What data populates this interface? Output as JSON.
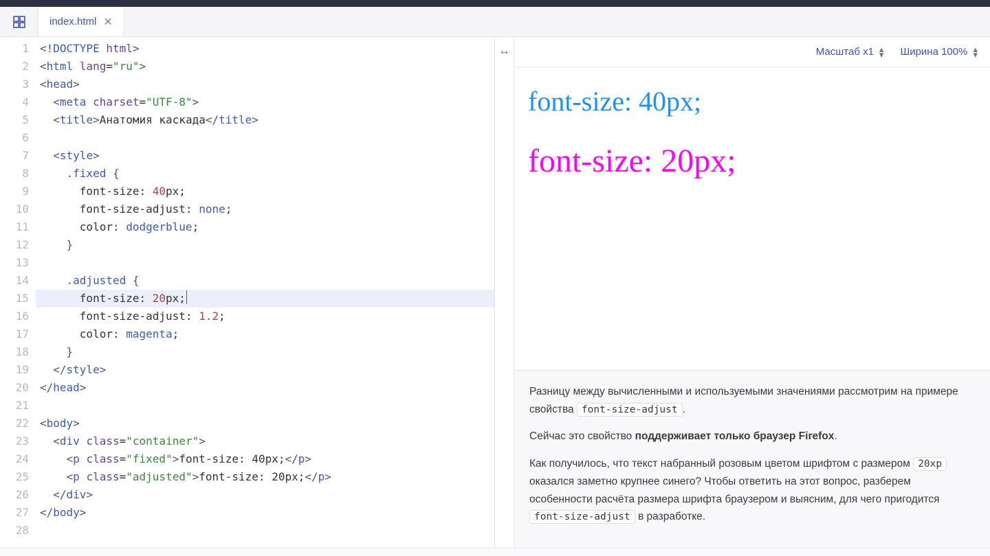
{
  "tab": {
    "filename": "index.html"
  },
  "toolbar": {
    "zoom_label": "Масштаб x1",
    "width_label": "Ширина 100%"
  },
  "editor": {
    "active_line": 15,
    "lines": [
      {
        "n": "1",
        "html": "<span class='cl-punct'>&lt;!</span><span class='cl-tag'>DOCTYPE</span> <span class='cl-attr'>html</span><span class='cl-punct'>&gt;</span>"
      },
      {
        "n": "2",
        "html": "<span class='cl-punct'>&lt;</span><span class='cl-tag'>html</span> <span class='cl-attr'>lang</span>=<span class='cl-str'>\"ru\"</span><span class='cl-punct'>&gt;</span>"
      },
      {
        "n": "3",
        "html": "<span class='cl-punct'>&lt;</span><span class='cl-tag'>head</span><span class='cl-punct'>&gt;</span>"
      },
      {
        "n": "4",
        "html": "  <span class='cl-punct'>&lt;</span><span class='cl-tag'>meta</span> <span class='cl-attr'>charset</span>=<span class='cl-str'>\"UTF-8\"</span><span class='cl-punct'>&gt;</span>"
      },
      {
        "n": "5",
        "html": "  <span class='cl-punct'>&lt;</span><span class='cl-tag'>title</span><span class='cl-punct'>&gt;</span><span class='cl-text'>Анатомия каскада</span><span class='cl-punct'>&lt;/</span><span class='cl-tag'>title</span><span class='cl-punct'>&gt;</span>"
      },
      {
        "n": "6",
        "html": ""
      },
      {
        "n": "7",
        "html": "  <span class='cl-punct'>&lt;</span><span class='cl-tag'>style</span><span class='cl-punct'>&gt;</span>"
      },
      {
        "n": "8",
        "html": "    <span class='cl-css'>.fixed</span> <span class='cl-punct'>{</span>"
      },
      {
        "n": "9",
        "html": "      <span class='cl-text'>font-size:</span> <span class='cl-num'>40</span><span class='cl-text'>px;</span>"
      },
      {
        "n": "10",
        "html": "      <span class='cl-text'>font-size-adjust:</span> <span class='cl-val'>none</span><span class='cl-text'>;</span>"
      },
      {
        "n": "11",
        "html": "      <span class='cl-text'>color:</span> <span class='cl-val'>dodgerblue</span><span class='cl-text'>;</span>"
      },
      {
        "n": "12",
        "html": "    <span class='cl-punct'>}</span>"
      },
      {
        "n": "13",
        "html": ""
      },
      {
        "n": "14",
        "html": "    <span class='cl-css'>.adjusted</span> <span class='cl-punct'>{</span>"
      },
      {
        "n": "15",
        "html": "      <span class='cl-text'>font-size:</span> <span class='cl-num'>20</span><span class='cl-text'>px;</span>",
        "hl": true,
        "caret": true
      },
      {
        "n": "16",
        "html": "      <span class='cl-text'>font-size-adjust:</span> <span class='cl-num'>1.2</span><span class='cl-text'>;</span>"
      },
      {
        "n": "17",
        "html": "      <span class='cl-text'>color:</span> <span class='cl-val'>magenta</span><span class='cl-text'>;</span>"
      },
      {
        "n": "18",
        "html": "    <span class='cl-punct'>}</span>"
      },
      {
        "n": "19",
        "html": "  <span class='cl-punct'>&lt;/</span><span class='cl-tag'>style</span><span class='cl-punct'>&gt;</span>"
      },
      {
        "n": "20",
        "html": "<span class='cl-punct'>&lt;/</span><span class='cl-tag'>head</span><span class='cl-punct'>&gt;</span>"
      },
      {
        "n": "21",
        "html": ""
      },
      {
        "n": "22",
        "html": "<span class='cl-punct'>&lt;</span><span class='cl-tag'>body</span><span class='cl-punct'>&gt;</span>"
      },
      {
        "n": "23",
        "html": "  <span class='cl-punct'>&lt;</span><span class='cl-tag'>div</span> <span class='cl-attr'>class</span>=<span class='cl-str'>\"container\"</span><span class='cl-punct'>&gt;</span>"
      },
      {
        "n": "24",
        "html": "    <span class='cl-punct'>&lt;</span><span class='cl-tag'>p</span> <span class='cl-attr'>class</span>=<span class='cl-str'>\"fixed\"</span><span class='cl-punct'>&gt;</span><span class='cl-text'>font-size: 40px;</span><span class='cl-punct'>&lt;/</span><span class='cl-tag'>p</span><span class='cl-punct'>&gt;</span>"
      },
      {
        "n": "25",
        "html": "    <span class='cl-punct'>&lt;</span><span class='cl-tag'>p</span> <span class='cl-attr'>class</span>=<span class='cl-str'>\"adjusted\"</span><span class='cl-punct'>&gt;</span><span class='cl-text'>font-size: 20px;</span><span class='cl-punct'>&lt;/</span><span class='cl-tag'>p</span><span class='cl-punct'>&gt;</span>"
      },
      {
        "n": "26",
        "html": "  <span class='cl-punct'>&lt;/</span><span class='cl-tag'>div</span><span class='cl-punct'>&gt;</span>"
      },
      {
        "n": "27",
        "html": "<span class='cl-punct'>&lt;/</span><span class='cl-tag'>body</span><span class='cl-punct'>&gt;</span>"
      },
      {
        "n": "28",
        "html": ""
      }
    ]
  },
  "preview": {
    "line1": "font-size: 40px;",
    "line2": "font-size: 20px;"
  },
  "notes": {
    "p1_a": "Разницу между вычисленными и используемыми значениями рассмотрим на примере свойства ",
    "p1_code": "font-size-adjust",
    "p1_b": ".",
    "p2_a": "Сейчас это свойство ",
    "p2_bold": "поддерживает только браузер Firefox",
    "p2_b": ".",
    "p3_a": "Как получилось, что текст набранный розовым цветом шрифтом с размером ",
    "p3_code1": "20xp",
    "p3_b": " оказался заметно крупнее синего? Чтобы ответить на этот вопрос, разберем особенности расчёта размера шрифта браузером и выясним, для чего пригодится ",
    "p3_code2": "font-size-adjust",
    "p3_c": " в разработке."
  }
}
